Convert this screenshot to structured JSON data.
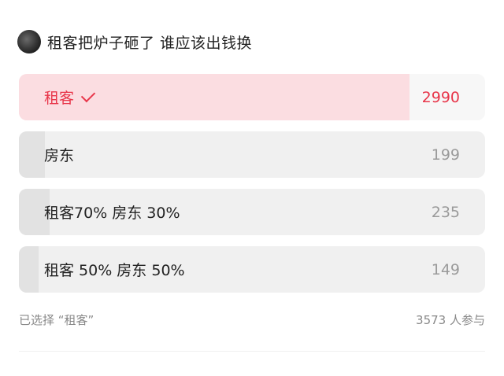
{
  "poll": {
    "question": "租客把炉子砸了 谁应该出钱换",
    "options": [
      {
        "label": "租客",
        "count": "2990",
        "selected": true,
        "share": 0.837
      },
      {
        "label": "房东",
        "count": "199",
        "selected": false,
        "share": 0.056
      },
      {
        "label": "租客70% 房东 30%",
        "count": "235",
        "selected": false,
        "share": 0.066
      },
      {
        "label": "租客 50% 房东 50%",
        "count": "149",
        "selected": false,
        "share": 0.042
      }
    ],
    "selected_text": "已选择 “租客”",
    "participants_text": "3573 人参与"
  },
  "colors": {
    "accent": "#e8364a",
    "selected_fill": "#fbdde1",
    "bar_fill": "#e2e2e2",
    "option_bg": "#f0f0f0",
    "muted_text": "#9a9a9a"
  },
  "icons": {
    "avatar": "avatar",
    "check": "check-icon"
  }
}
